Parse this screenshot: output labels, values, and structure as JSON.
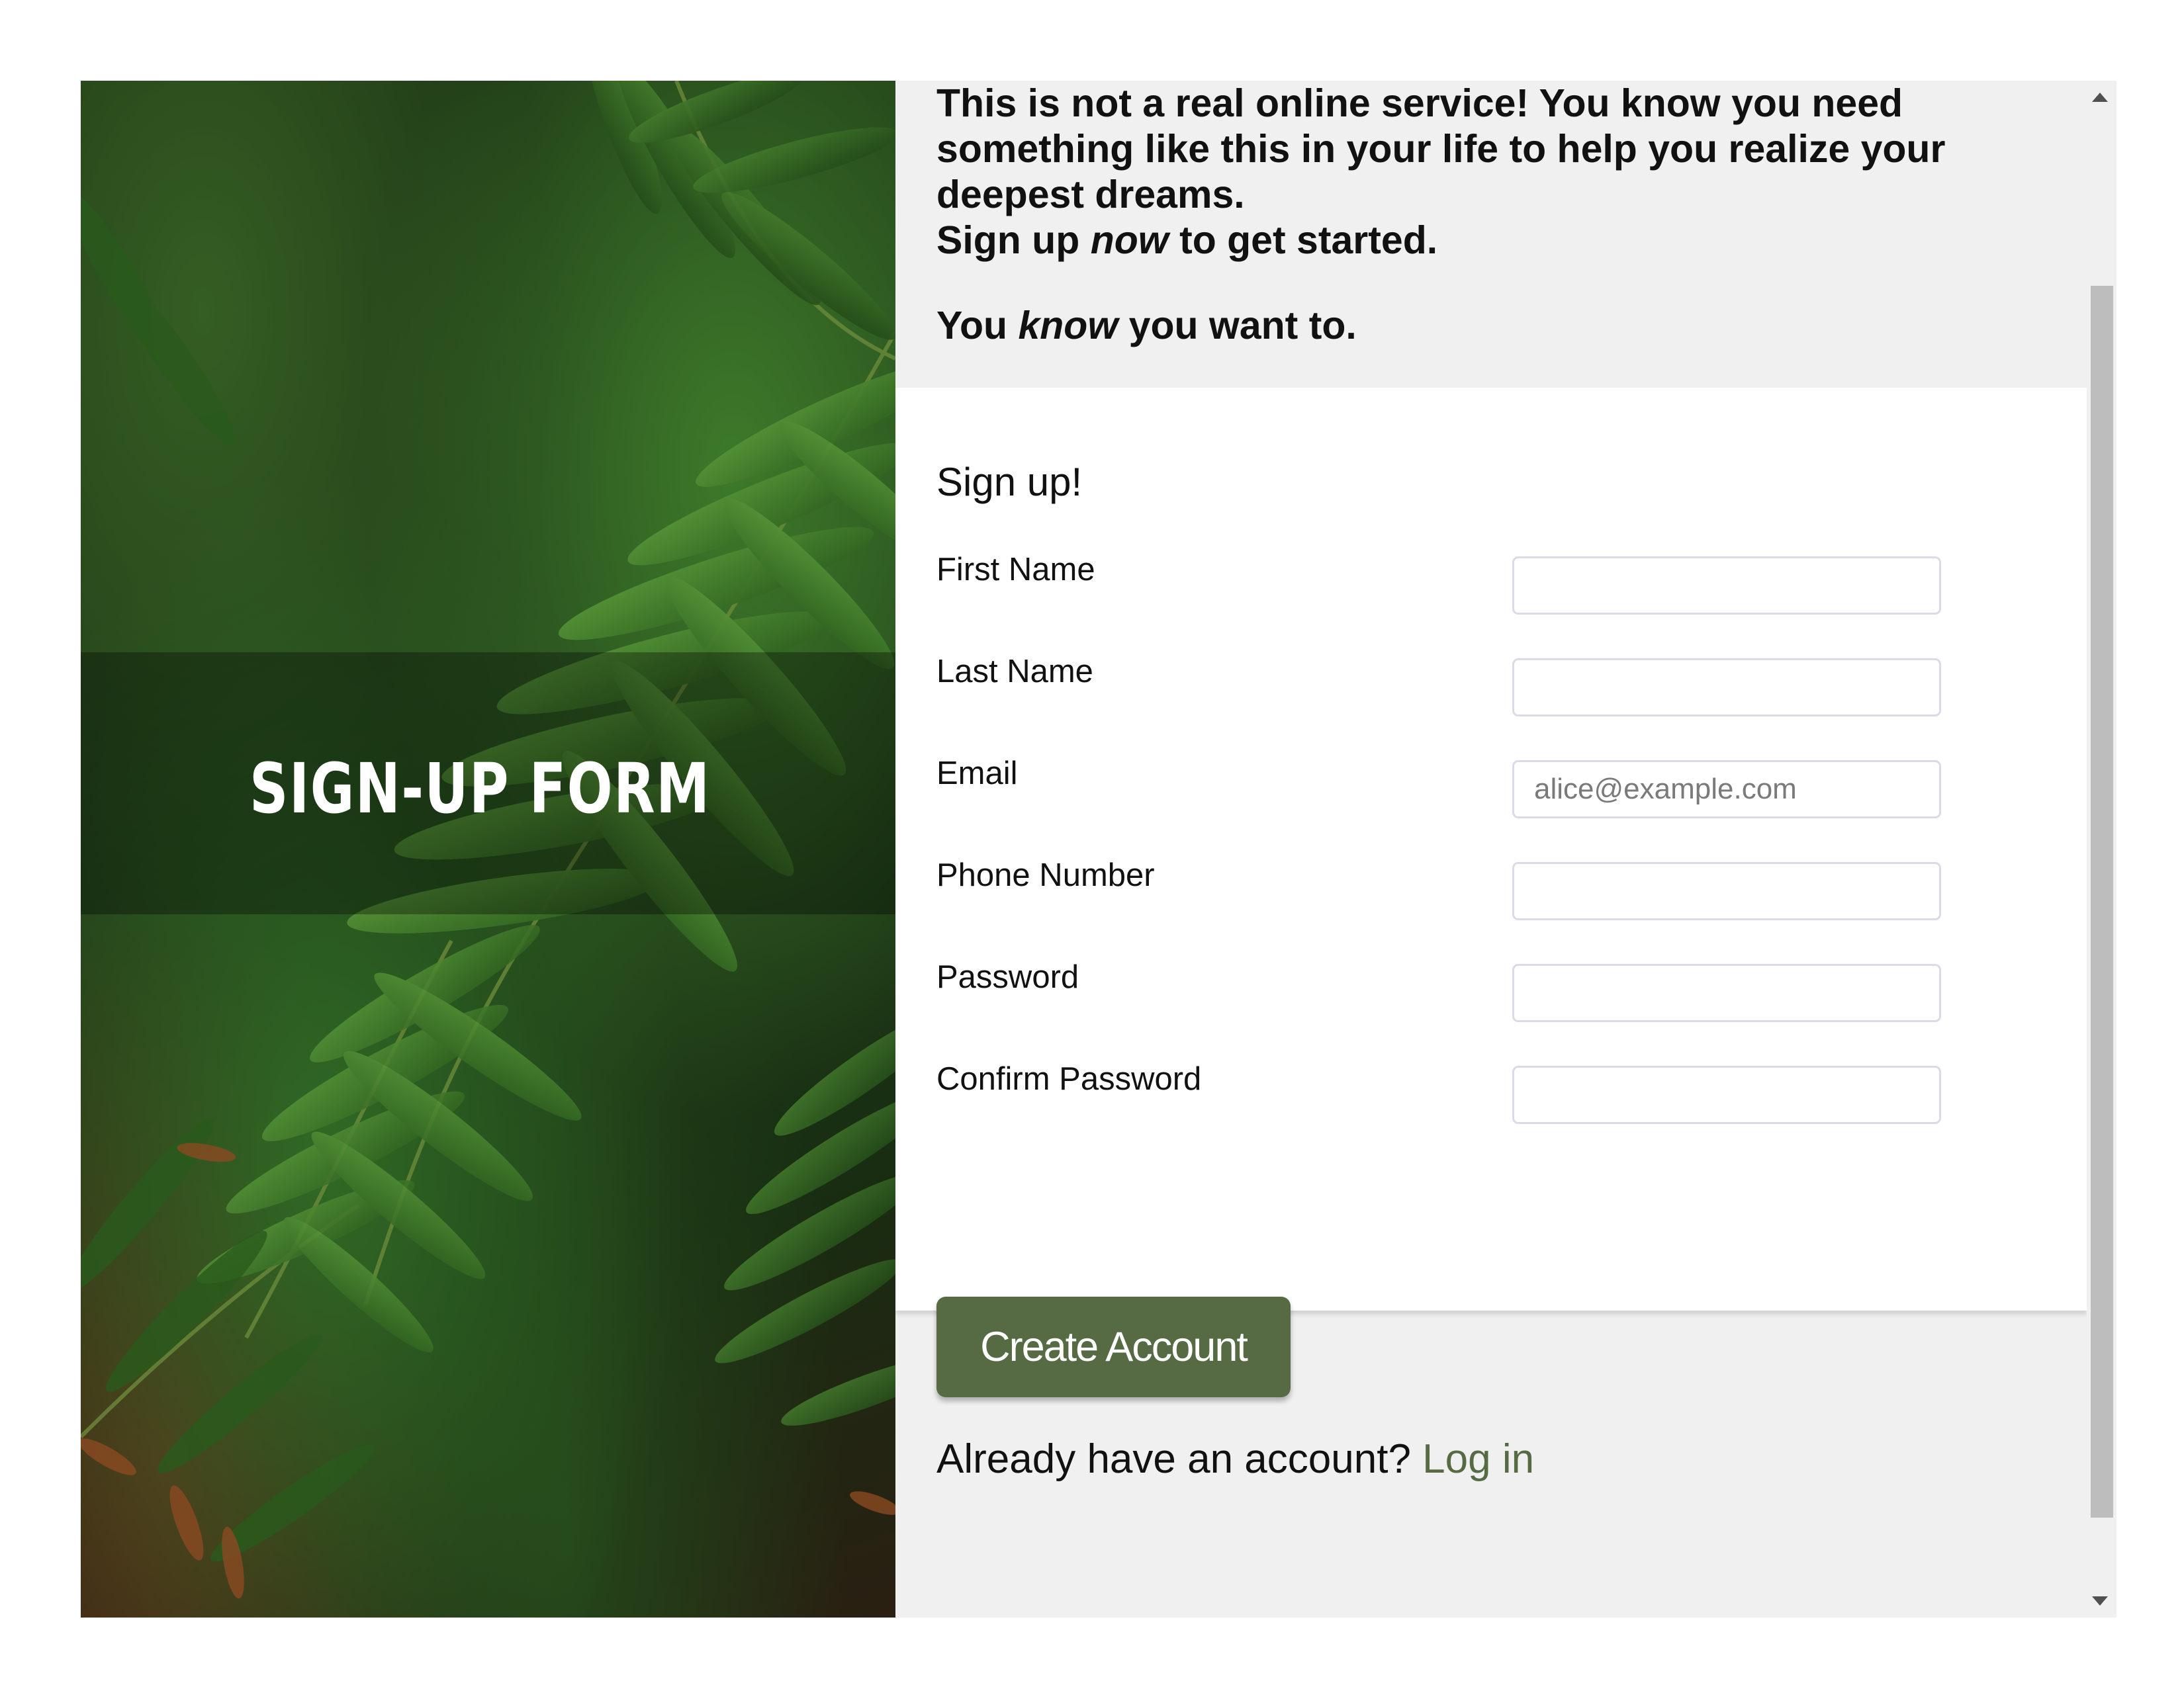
{
  "hero": {
    "logo_text": "SIGN-UP FORM",
    "logo_icon": "viking-helmet-mask-icon"
  },
  "intro": {
    "line1": "This is not a real online service! You know you need something like this in your life to help you realize your deepest dreams.",
    "line2_pre": "Sign up ",
    "line2_em": "now",
    "line2_post": " to get started.",
    "line3_pre": "You ",
    "line3_em": "know",
    "line3_post": " you want to."
  },
  "form": {
    "title": "Sign up!",
    "fields": [
      {
        "label": "First Name",
        "value": "",
        "placeholder": ""
      },
      {
        "label": "Last Name",
        "value": "",
        "placeholder": ""
      },
      {
        "label": "Email",
        "value": "",
        "placeholder": "alice@example.com"
      },
      {
        "label": "Phone Number",
        "value": "",
        "placeholder": ""
      },
      {
        "label": "Password",
        "value": "",
        "placeholder": ""
      },
      {
        "label": "Confirm Password",
        "value": "",
        "placeholder": ""
      }
    ]
  },
  "actions": {
    "create_label": "Create Account",
    "login_prompt": "Already have an account?",
    "login_link": "Log in"
  },
  "colors": {
    "accent": "#566b43",
    "panel_bg": "#f0f0f0"
  }
}
